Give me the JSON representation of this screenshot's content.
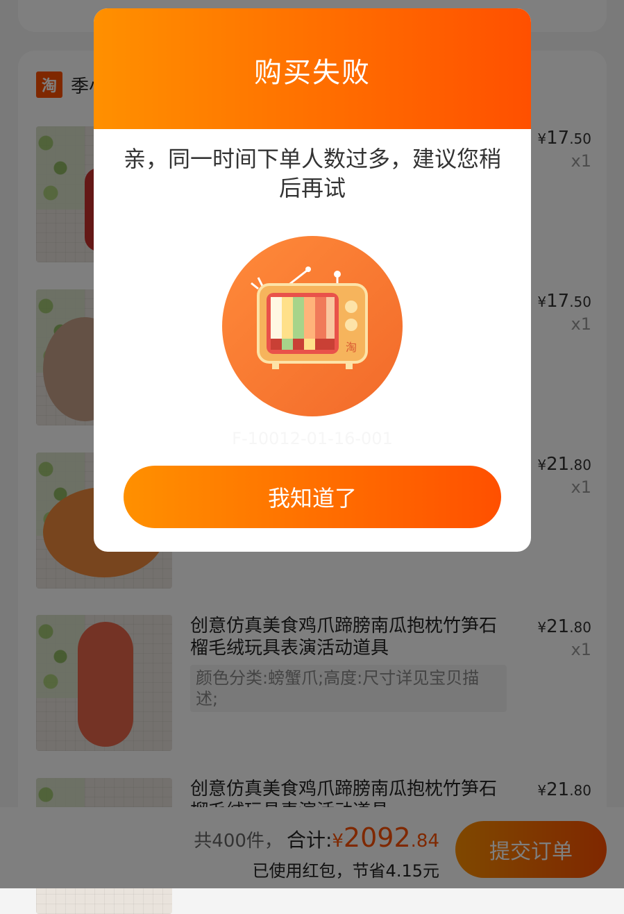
{
  "shop": {
    "logo_text": "淘",
    "name": "季小"
  },
  "items": [
    {
      "title": "",
      "sku": "",
      "price_int": "17",
      "price_dec": ".50",
      "currency": "¥",
      "qty": "x1"
    },
    {
      "title": "",
      "sku": "",
      "price_int": "17",
      "price_dec": ".50",
      "currency": "¥",
      "qty": "x1"
    },
    {
      "title": "",
      "sku": "",
      "price_int": "21",
      "price_dec": ".80",
      "currency": "¥",
      "qty": "x1"
    },
    {
      "title": "创意仿真美食鸡爪蹄膀南瓜抱枕竹笋石榴毛绒玩具表演活动道具",
      "sku": "颜色分类:螃蟹爪;高度:尺寸详见宝贝描述;",
      "price_int": "21",
      "price_dec": ".80",
      "currency": "¥",
      "qty": "x1"
    },
    {
      "title": "创意仿真美食鸡爪蹄膀南瓜抱枕竹笋石榴毛绒玩具表演活动道具",
      "sku": "",
      "price_int": "21",
      "price_dec": ".80",
      "currency": "¥",
      "qty": ""
    }
  ],
  "footer": {
    "count": "共400件，",
    "total_label": "合计:",
    "currency": "¥",
    "total_int": "2092",
    "total_dec": ".84",
    "savings": "已使用红包，节省4.15元",
    "submit": "提交订单"
  },
  "modal": {
    "title": "购买失败",
    "message": "亲，同一时间下单人数过多，建议您稍后再试",
    "error_code": "F-10012-01-16-001",
    "tv_badge": "淘",
    "ok_button": "我知道了"
  },
  "colors": {
    "accent_start": "#ff9000",
    "accent_end": "#ff5000"
  },
  "icons": {
    "shop_logo": "taobao-logo-icon",
    "illustration": "retro-tv-illustration"
  }
}
